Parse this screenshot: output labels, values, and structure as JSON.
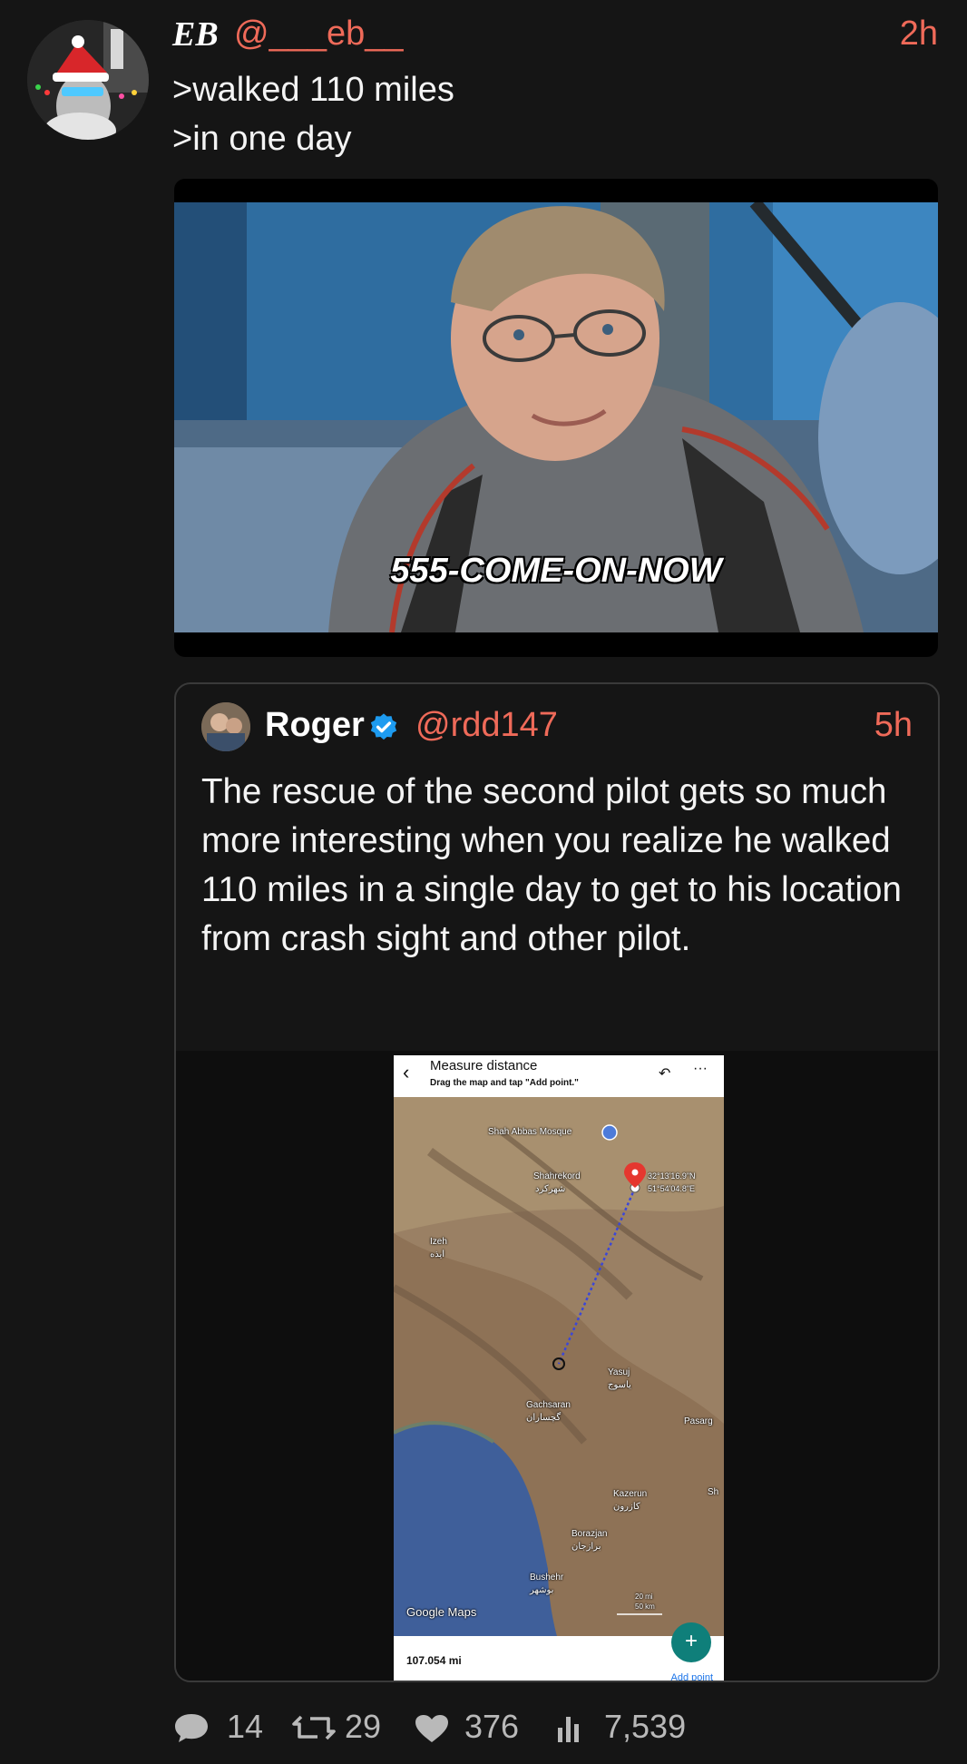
{
  "tweet": {
    "name": "EB",
    "handle": "@___eb__",
    "time": "2h",
    "lines": [
      ">walked 110 miles",
      ">in one day"
    ],
    "gif_caption": "555-COME-ON-NOW"
  },
  "quoted": {
    "name": "Roger",
    "handle": "@rdd147",
    "time": "5h",
    "text": "The rescue of the second pilot gets so much more interesting when you realize he walked 110 miles in a single day to get to his location from crash sight and other pilot.",
    "screenshot": {
      "title": "Measure distance",
      "subtitle": "Drag the map and tap \"Add point.\"",
      "map_labels": {
        "mosque": "Shah Abbas Mosque",
        "shahrekord": "Shahrekord",
        "shahrekord_fa": "شهرکرد",
        "coord1": "32°13'16.9\"N",
        "coord2": "51°54'04.8\"E",
        "izeh": "Izeh",
        "izeh_fa": "ایذه",
        "yasuj": "Yasuj",
        "yasuj_fa": "یاسوج",
        "gachsaran": "Gachsaran",
        "gachsaran_fa": "گچساران",
        "pasarg": "Pasarg",
        "kazerun": "Kazerun",
        "kazerun_fa": "کازرون",
        "borazjan": "Borazjan",
        "borazjan_fa": "برازجان",
        "bushehr": "Bushehr",
        "bushehr_fa": "بوشهر",
        "sh": "Sh",
        "scale1": "20 mi",
        "scale2": "50 km",
        "google": "Google Maps"
      },
      "distance": "107.054 mi",
      "add_point": "Add point",
      "fab": "+"
    }
  },
  "stats": {
    "replies": "14",
    "retweets": "29",
    "likes": "376",
    "views": "7,539"
  },
  "colors": {
    "accent": "#ef6a59",
    "background": "#151515",
    "verified": "#1d9bf0"
  }
}
